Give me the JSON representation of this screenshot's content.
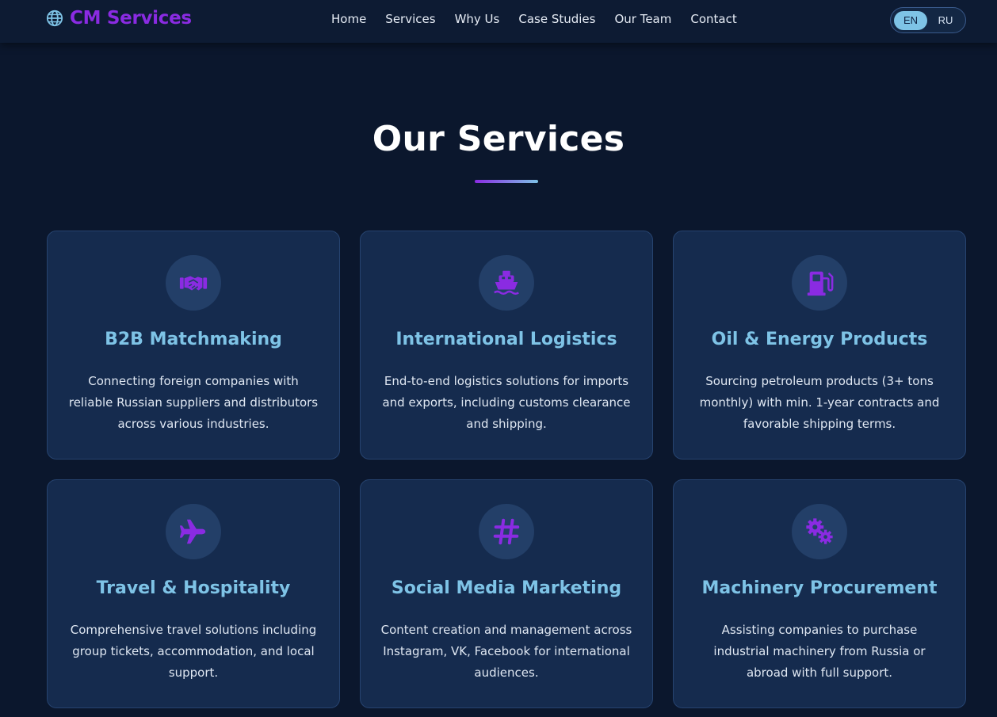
{
  "brand": {
    "name": "CM Services",
    "icon": "globe-icon",
    "color": "#8a2be2"
  },
  "nav": {
    "links": [
      {
        "label": "Home"
      },
      {
        "label": "Services"
      },
      {
        "label": "Why Us"
      },
      {
        "label": "Case Studies"
      },
      {
        "label": "Our Team"
      },
      {
        "label": "Contact"
      }
    ]
  },
  "language": {
    "options": [
      "EN",
      "RU"
    ],
    "active": "EN"
  },
  "section": {
    "title": "Our Services"
  },
  "colors": {
    "background": "#0b172d",
    "card": "#152b4e",
    "accent": "#7ec3e6",
    "icon": "#8a2be2"
  },
  "services": [
    {
      "icon": "handshake-icon",
      "title": "B2B Matchmaking",
      "description": "Connecting foreign companies with reliable Russian suppliers and distributors across various industries."
    },
    {
      "icon": "ship-icon",
      "title": "International Logistics",
      "description": "End-to-end logistics solutions for imports and exports, including customs clearance and shipping."
    },
    {
      "icon": "gas-pump-icon",
      "title": "Oil & Energy Products",
      "description": "Sourcing petroleum products (3+ tons monthly) with min. 1-year contracts and favorable shipping terms."
    },
    {
      "icon": "plane-icon",
      "title": "Travel & Hospitality",
      "description": "Comprehensive travel solutions including group tickets, accommodation, and local support."
    },
    {
      "icon": "hashtag-icon",
      "title": "Social Media Marketing",
      "description": "Content creation and management across Instagram, VK, Facebook for international audiences."
    },
    {
      "icon": "gears-icon",
      "title": "Machinery Procurement",
      "description": "Assisting companies to purchase industrial machinery from Russia or abroad with full support."
    }
  ]
}
